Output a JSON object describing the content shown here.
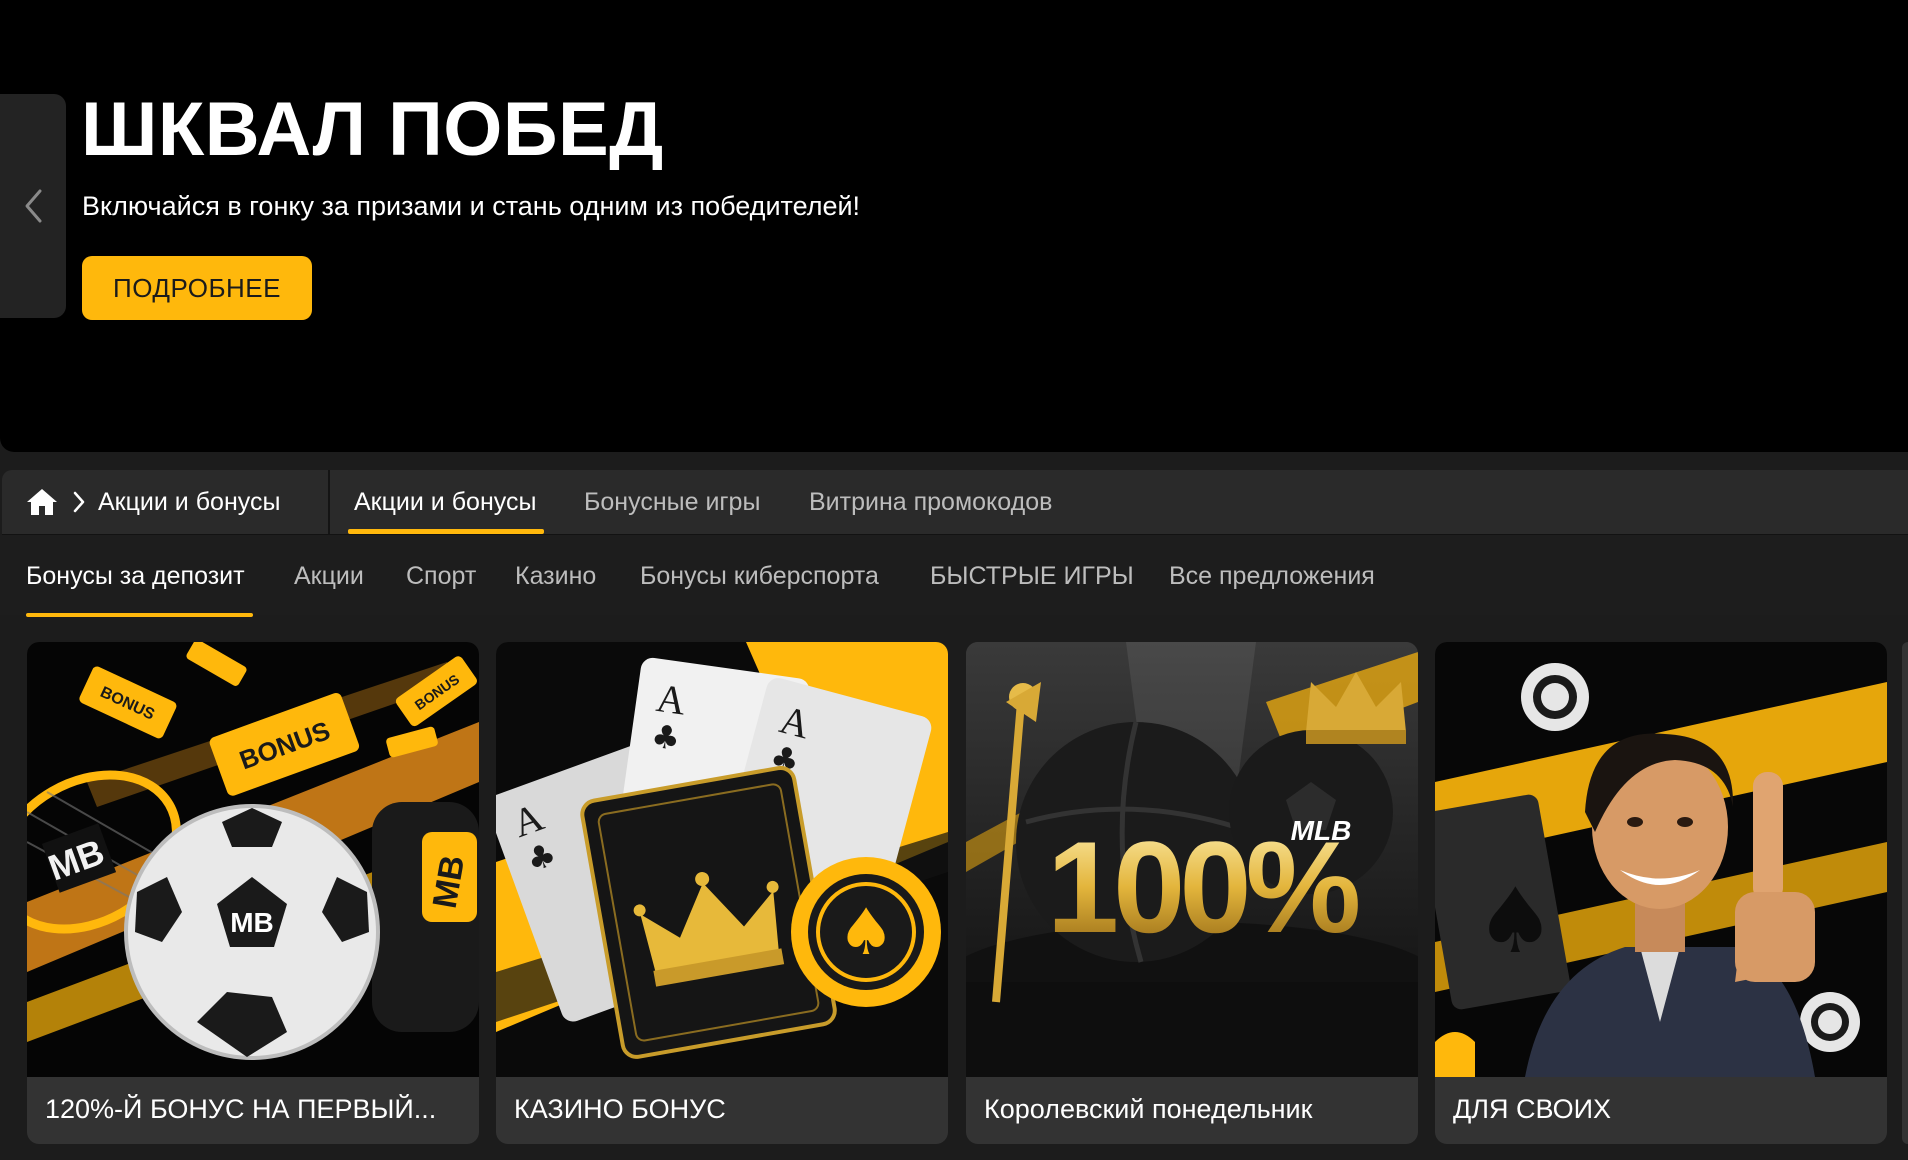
{
  "hero": {
    "title": "ШКВАЛ ПОБЕД",
    "subtitle": "Включайся в гонку за призами и стань одним из победителей!",
    "button_label": "ПОДРОБНЕЕ",
    "prev_icon": "chevron-left-icon"
  },
  "breadcrumb": {
    "home_icon": "home-icon",
    "separator_icon": "chevron-right-icon",
    "label": "Акции и бонусы"
  },
  "section_tabs": [
    {
      "label": "Акции и бонусы",
      "active": true
    },
    {
      "label": "Бонусные игры",
      "active": false
    },
    {
      "label": "Витрина промокодов",
      "active": false
    }
  ],
  "category_tabs": [
    {
      "label": "Бонусы за депозит",
      "active": true
    },
    {
      "label": "Акции",
      "active": false
    },
    {
      "label": "Спорт",
      "active": false
    },
    {
      "label": "Казино",
      "active": false
    },
    {
      "label": "Бонусы киберспорта",
      "active": false
    },
    {
      "label": "БЫСТРЫЕ ИГРЫ",
      "active": false
    },
    {
      "label": "Все предложения",
      "active": false
    }
  ],
  "cards": [
    {
      "title": "120%-Й БОНУС НА ПЕРВЫЙ...",
      "image": "soccer-ball-bonus-tickets",
      "img_badge": "MB"
    },
    {
      "title": "КАЗИНО БОНУС",
      "image": "playing-cards-crown-chip",
      "img_badge": "A"
    },
    {
      "title": "Королевский понедельник",
      "image": "balls-100-percent-crown",
      "img_badge": "100%"
    },
    {
      "title": "ДЛЯ СВОИХ",
      "image": "man-thumbs-up",
      "img_badge": ""
    }
  ],
  "colors": {
    "accent": "#ffb80c",
    "hero_bg": "#000000",
    "nav_bg": "#2a2a2a",
    "card_bg": "#333333"
  }
}
